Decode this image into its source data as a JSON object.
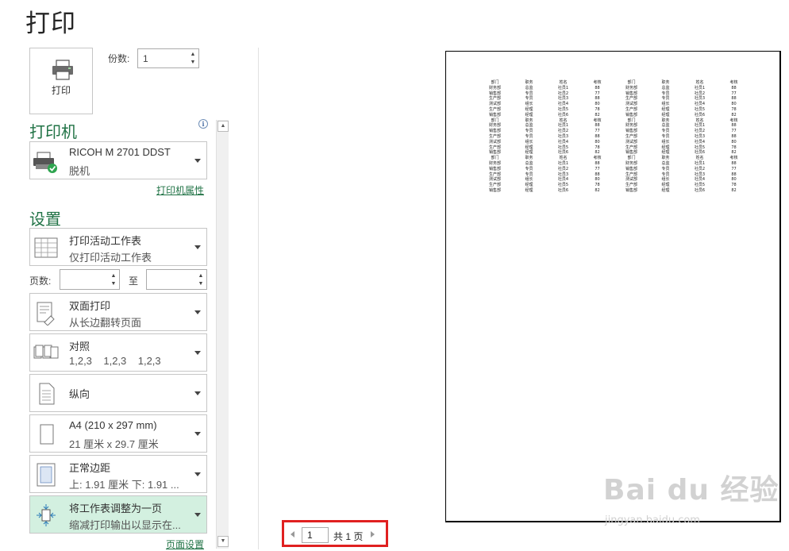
{
  "title": "打印",
  "print_button": {
    "label": "打印",
    "icon": "printer-icon"
  },
  "copies": {
    "label": "份数:",
    "value": "1"
  },
  "printer": {
    "heading": "打印机",
    "name": "RICOH M 2701 DDST",
    "status": "脱机",
    "properties_link": "打印机属性"
  },
  "settings": {
    "heading": "设置",
    "items": [
      {
        "line1": "打印活动工作表",
        "line2": "仅打印活动工作表",
        "icon": "worksheet-icon"
      },
      {
        "line1": "双面打印",
        "line2": "从长边翻转页面",
        "icon": "duplex-icon"
      },
      {
        "line1": "对照",
        "line2": "1,2,3    1,2,3    1,2,3",
        "icon": "collate-icon"
      },
      {
        "line1": "纵向",
        "line2": "",
        "icon": "portrait-icon"
      },
      {
        "line1": "A4 (210 x 297 mm)",
        "line2": "21 厘米 x 29.7 厘米",
        "icon": "paper-size-icon"
      },
      {
        "line1": "正常边距",
        "line2": "上: 1.91 厘米 下: 1.91 ...",
        "icon": "margins-icon"
      },
      {
        "line1": "将工作表调整为一页",
        "line2": "缩减打印输出以显示在...",
        "icon": "fit-to-page-icon"
      }
    ],
    "pages_label": "页数:",
    "to_label": "至",
    "page_setup_link": "页面设置"
  },
  "navigation": {
    "current_page": "1",
    "total_label": "共 1 页"
  },
  "preview": {
    "header": [
      "部门",
      "职务",
      "姓名",
      "考核",
      "部门",
      "职务",
      "姓名",
      "考核"
    ],
    "rows": [
      [
        "财务部",
        "总监",
        "社员1",
        "88",
        "财务部",
        "总监",
        "社员1",
        "88"
      ],
      [
        "销售部",
        "专员",
        "社员2",
        "77",
        "销售部",
        "专员",
        "社员2",
        "77"
      ],
      [
        "生产部",
        "专员",
        "社员3",
        "88",
        "生产部",
        "专员",
        "社员3",
        "88"
      ],
      [
        "测试部",
        "组长",
        "社员4",
        "80",
        "测试部",
        "组长",
        "社员4",
        "80"
      ],
      [
        "生产部",
        "经理",
        "社员5",
        "78",
        "生产部",
        "经理",
        "社员5",
        "78"
      ],
      [
        "销售部",
        "经理",
        "社员6",
        "82",
        "销售部",
        "经理",
        "社员6",
        "82"
      ]
    ],
    "blocks": 3
  },
  "watermark": {
    "main": "Bai du 经验",
    "sub": "jingyan.baidu.com"
  }
}
